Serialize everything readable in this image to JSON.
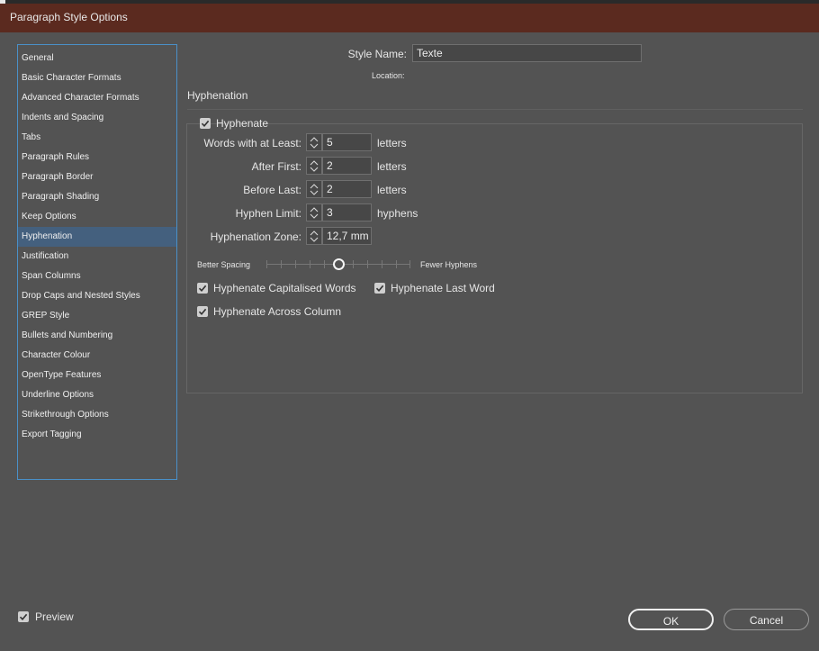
{
  "window": {
    "title": "Paragraph Style Options"
  },
  "sidebar": {
    "items": [
      {
        "label": "General"
      },
      {
        "label": "Basic Character Formats"
      },
      {
        "label": "Advanced Character Formats"
      },
      {
        "label": "Indents and Spacing"
      },
      {
        "label": "Tabs"
      },
      {
        "label": "Paragraph Rules"
      },
      {
        "label": "Paragraph Border"
      },
      {
        "label": "Paragraph Shading"
      },
      {
        "label": "Keep Options"
      },
      {
        "label": "Hyphenation",
        "selected": true
      },
      {
        "label": "Justification"
      },
      {
        "label": "Span Columns"
      },
      {
        "label": "Drop Caps and Nested Styles"
      },
      {
        "label": "GREP Style"
      },
      {
        "label": "Bullets and Numbering"
      },
      {
        "label": "Character Colour"
      },
      {
        "label": "OpenType Features"
      },
      {
        "label": "Underline Options"
      },
      {
        "label": "Strikethrough Options"
      },
      {
        "label": "Export Tagging"
      }
    ]
  },
  "style": {
    "name_label": "Style Name:",
    "name_value": "Texte",
    "location_label": "Location:"
  },
  "section": {
    "title": "Hyphenation"
  },
  "hyphenation": {
    "enabled_label": "Hyphenate",
    "enabled": true,
    "fields": [
      {
        "label": "Words with at Least:",
        "value": "5",
        "unit": "letters"
      },
      {
        "label": "After First:",
        "value": "2",
        "unit": "letters"
      },
      {
        "label": "Before Last:",
        "value": "2",
        "unit": "letters"
      },
      {
        "label": "Hyphen Limit:",
        "value": "3",
        "unit": "hyphens"
      },
      {
        "label": "Hyphenation Zone:",
        "value": "12,7 mm",
        "unit": ""
      }
    ],
    "slider": {
      "left_label": "Better Spacing",
      "right_label": "Fewer Hyphens",
      "position": 0.5
    },
    "options": [
      {
        "label": "Hyphenate Capitalised Words",
        "checked": true
      },
      {
        "label": "Hyphenate Last Word",
        "checked": true
      },
      {
        "label": "Hyphenate Across Column",
        "checked": true
      }
    ]
  },
  "footer": {
    "preview_label": "Preview",
    "preview_checked": true,
    "ok_label": "OK",
    "cancel_label": "Cancel"
  },
  "colors": {
    "title_bar": "#5b2a1f",
    "dialog_bg": "#535353",
    "selection": "#44607e",
    "focus_border": "#4a90c8"
  }
}
